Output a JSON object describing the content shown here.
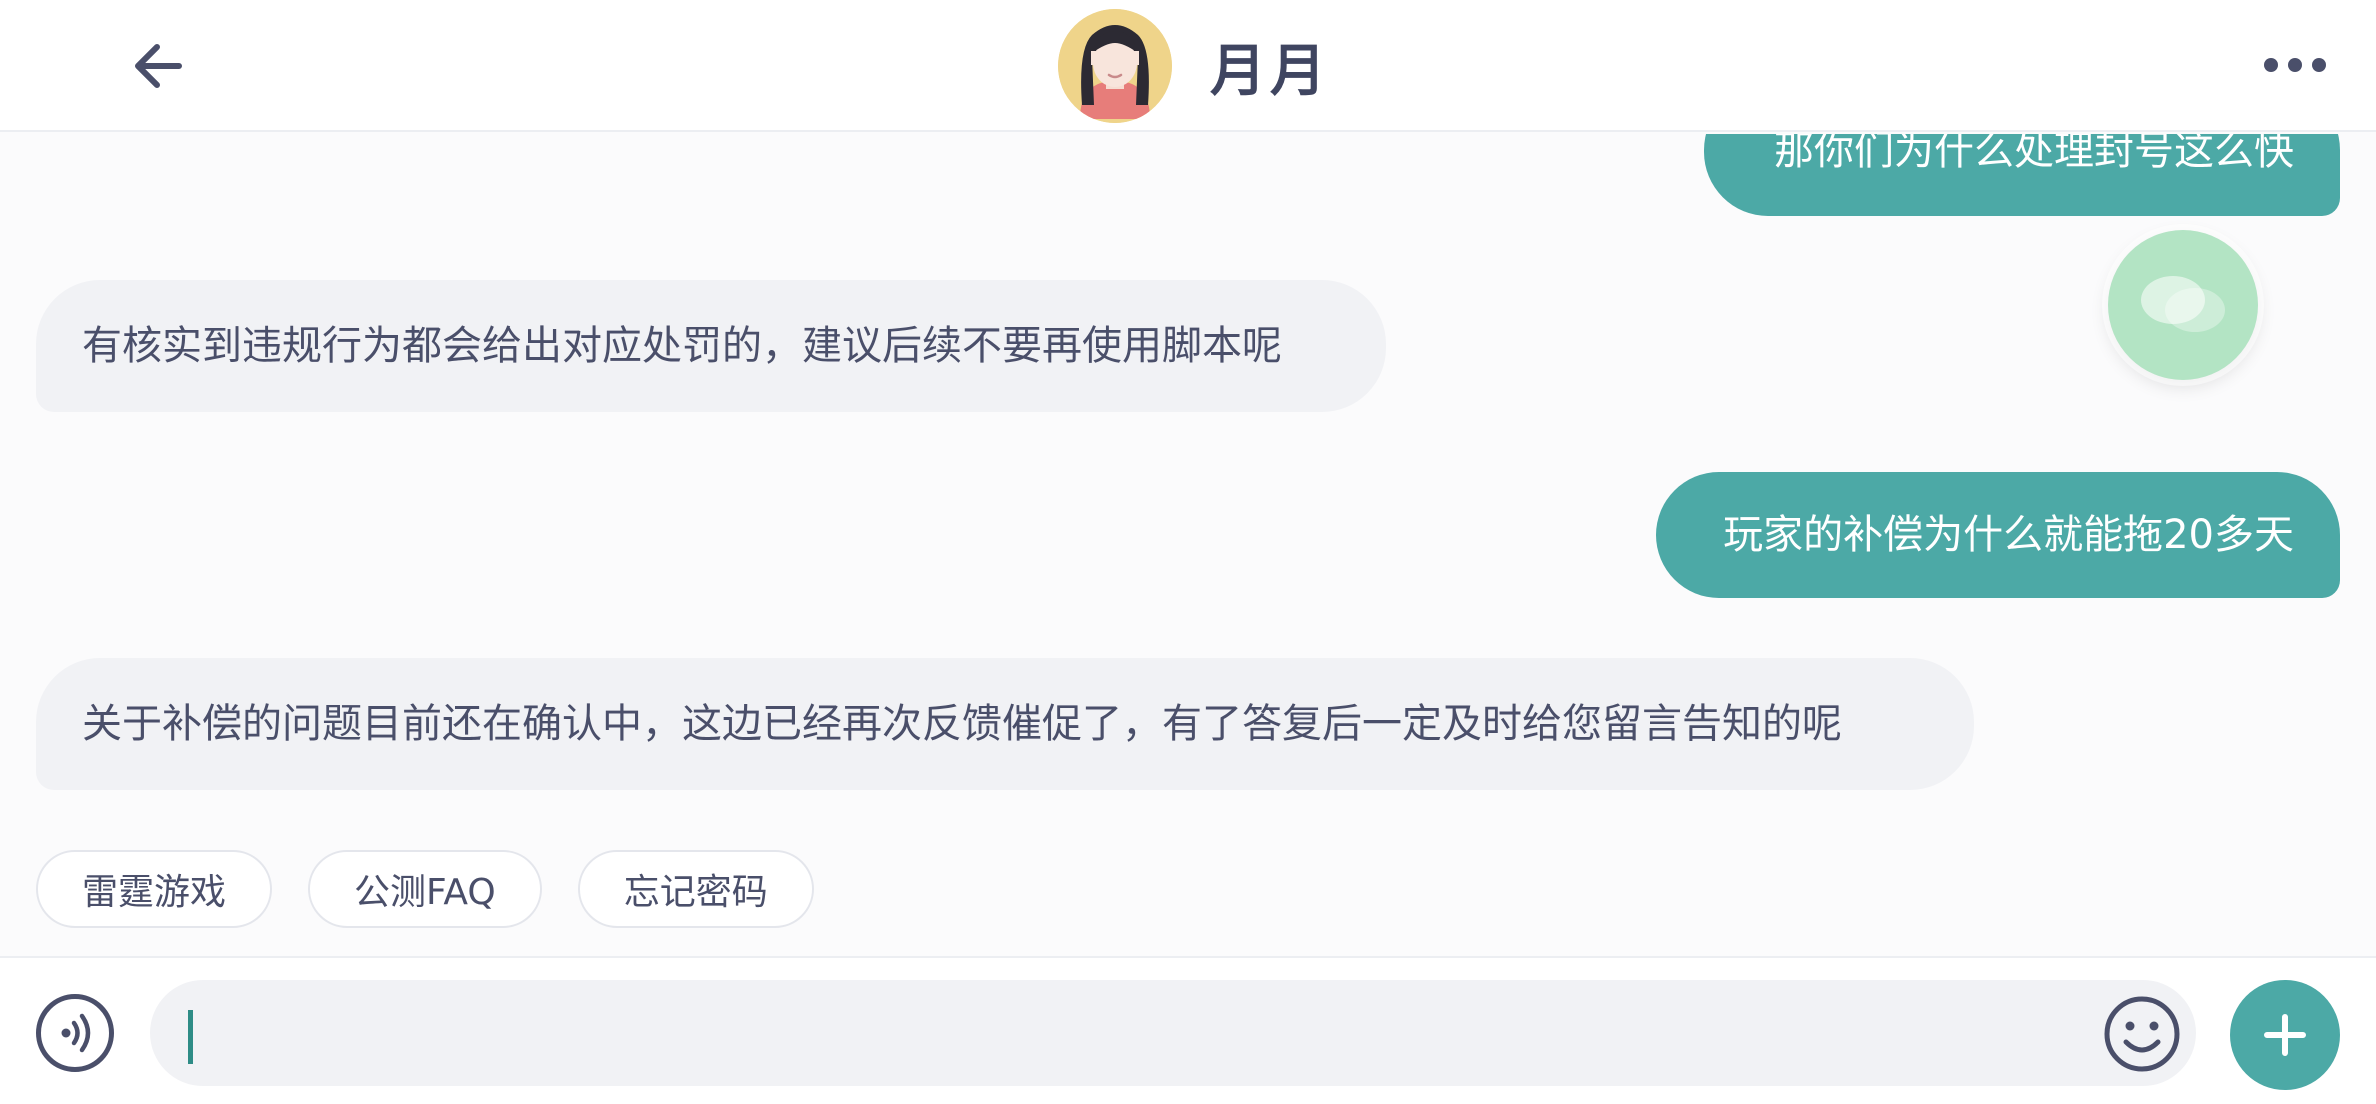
{
  "header": {
    "contact_name": "月月",
    "back_icon": "arrow-left-icon",
    "more_icon": "more-horizontal-icon"
  },
  "messages": [
    {
      "direction": "outgoing",
      "text": "那你们为什么处理封号这么快"
    },
    {
      "direction": "incoming",
      "text": "有核实到违规行为都会给出对应处罚的，建议后续不要再使用脚本呢"
    },
    {
      "direction": "outgoing",
      "text": "玩家的补偿为什么就能拖20多天"
    },
    {
      "direction": "incoming",
      "text": "关于补偿的问题目前还在确认中，这边已经再次反馈催促了，有了答复后一定及时给您留言告知的呢"
    }
  ],
  "quick_replies": [
    "雷霆游戏",
    "公测FAQ",
    "忘记密码"
  ],
  "input": {
    "value": "",
    "voice_icon": "voice-icon",
    "emoji_icon": "emoji-icon",
    "plus_icon": "plus-icon"
  },
  "colors": {
    "accent": "#4ca9a6",
    "incoming_bubble": "#f1f2f5",
    "text": "#4a4f6a"
  }
}
